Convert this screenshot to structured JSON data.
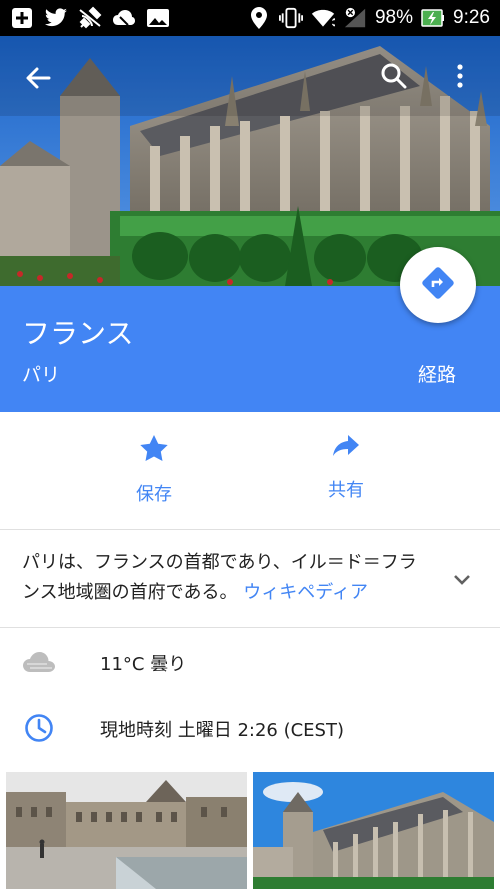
{
  "status_bar": {
    "battery_percent": "98%",
    "time": "9:26",
    "left_icons": [
      "plus-box-icon",
      "twitter-icon",
      "satellite-icon",
      "cloud-icon",
      "image-icon"
    ],
    "right_icons": [
      "location-icon",
      "vibrate-icon",
      "wifi-icon",
      "signal-icon",
      "battery-charging-icon"
    ]
  },
  "toolbar": {
    "icons": [
      "back-arrow-icon",
      "search-icon",
      "more-vert-icon"
    ]
  },
  "place": {
    "title": "フランス",
    "subtitle": "パリ",
    "route_label": "経路"
  },
  "actions": {
    "save_label": "保存",
    "share_label": "共有"
  },
  "description": {
    "text": "パリは、フランスの首都であり、イル＝ド＝フランス地域圏の首府である。",
    "link": "ウィキペディア"
  },
  "weather": {
    "text": "11°C 曇り"
  },
  "local_time": {
    "text": "現地時刻 土曜日 2:26 (CEST)"
  },
  "colors": {
    "accent": "#4285f4",
    "status_bar": "#000000",
    "time_icon": "#4285f4",
    "weather_icon": "#bdbdbd"
  }
}
